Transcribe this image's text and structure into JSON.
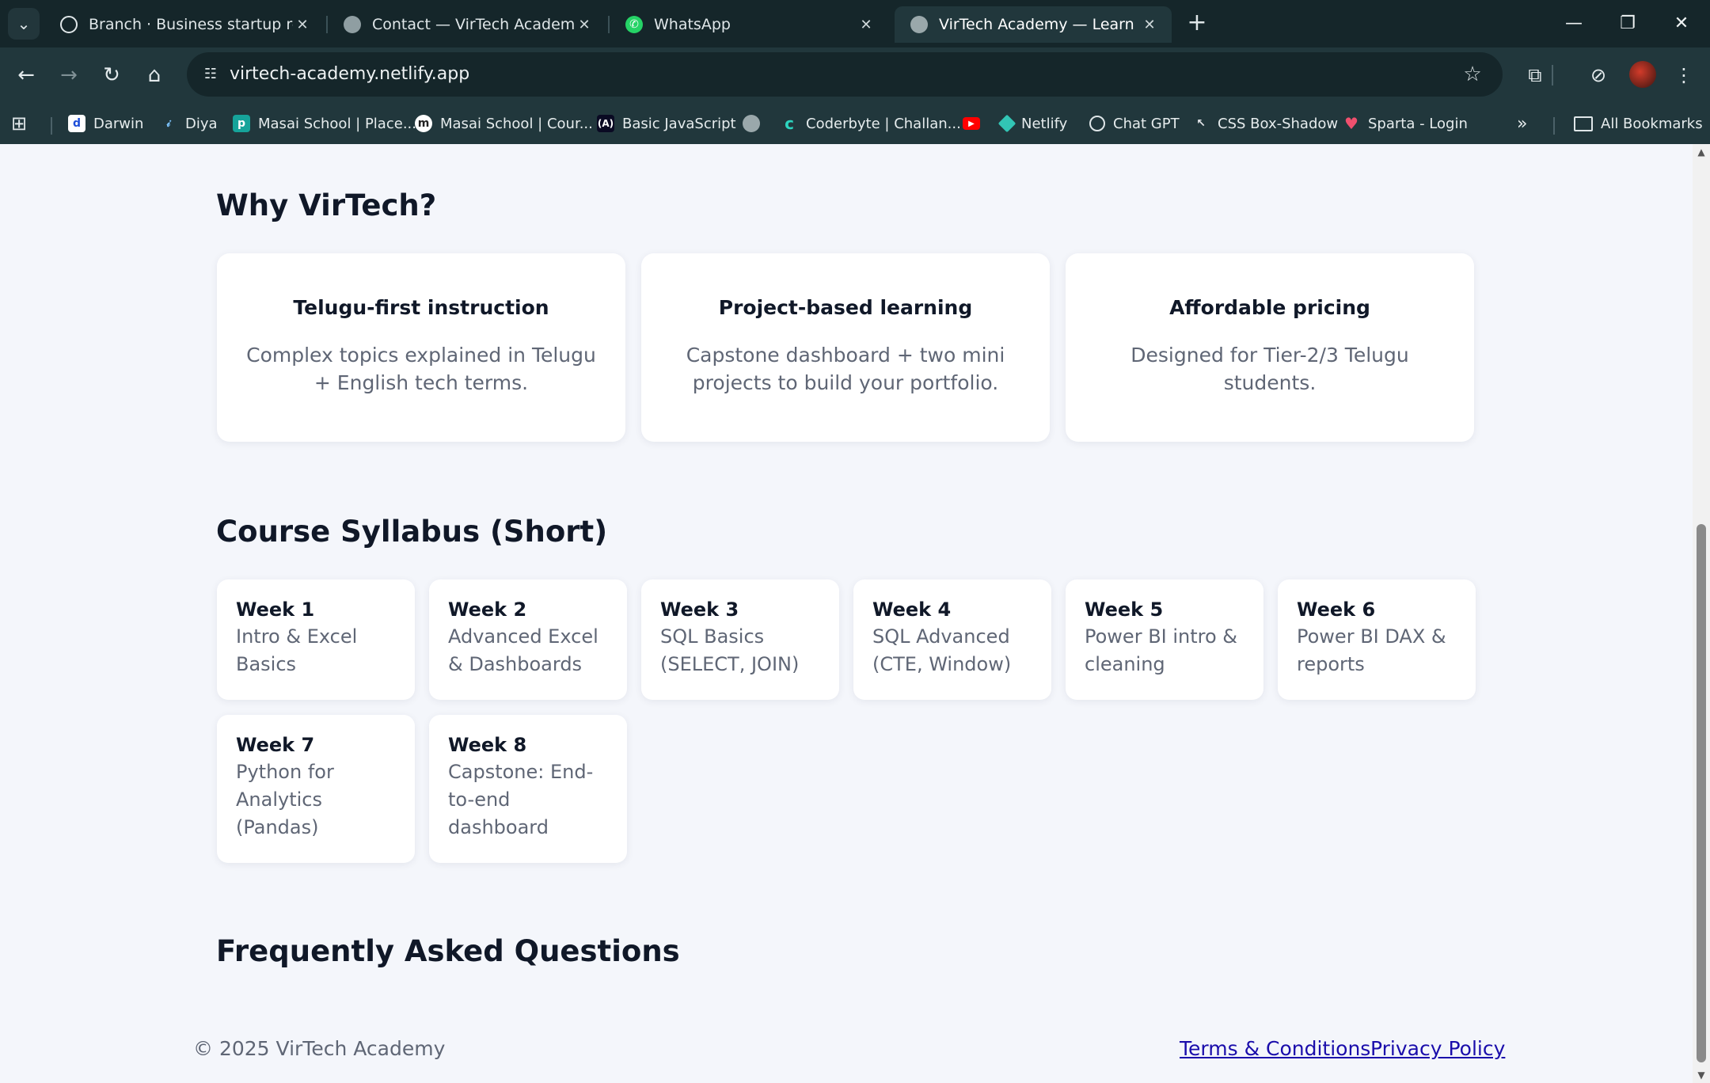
{
  "browser": {
    "tabs": [
      {
        "title": "Branch · Business startup roadm",
        "icon": "chatgpt-icon"
      },
      {
        "title": "Contact — VirTech Academy",
        "icon": "globe-icon"
      },
      {
        "title": "WhatsApp",
        "icon": "whatsapp-icon"
      },
      {
        "title": "VirTech Academy — Learn Data",
        "icon": "globe-icon",
        "active": true
      }
    ],
    "url": "virtech-academy.netlify.app",
    "bookmarks": [
      {
        "label": "Darwin",
        "icon": "d"
      },
      {
        "label": "Diya",
        "icon": "diya"
      },
      {
        "label": "Masai School | Place...",
        "icon": "p"
      },
      {
        "label": "Masai School | Cour...",
        "icon": "m"
      },
      {
        "label": "Basic JavaScript",
        "icon": "A"
      },
      {
        "label": "",
        "icon": "globe"
      },
      {
        "label": "Coderbyte | Challan...",
        "icon": "c"
      },
      {
        "label": "",
        "icon": "youtube"
      },
      {
        "label": "Netlify",
        "icon": "netlify"
      },
      {
        "label": "Chat GPT",
        "icon": "chatgpt"
      },
      {
        "label": "CSS Box-Shadow",
        "icon": "css"
      },
      {
        "label": "Sparta - Login",
        "icon": "heart"
      }
    ],
    "all_bookmarks_label": "All Bookmarks"
  },
  "why": {
    "heading": "Why VirTech?",
    "cards": [
      {
        "title": "Telugu-first instruction",
        "desc": "Complex topics explained in Telugu + English tech terms."
      },
      {
        "title": "Project-based learning",
        "desc": "Capstone dashboard + two mini projects to build your portfolio."
      },
      {
        "title": "Affordable pricing",
        "desc": "Designed for Tier-2/3 Telugu students."
      }
    ]
  },
  "syllabus": {
    "heading": "Course Syllabus (Short)",
    "weeks": [
      {
        "title": "Week 1",
        "desc": "Intro & Excel Basics"
      },
      {
        "title": "Week 2",
        "desc": "Advanced Excel & Dashboards"
      },
      {
        "title": "Week 3",
        "desc": "SQL Basics (SELECT, JOIN)"
      },
      {
        "title": "Week 4",
        "desc": "SQL Advanced (CTE, Window)"
      },
      {
        "title": "Week 5",
        "desc": "Power BI intro & cleaning"
      },
      {
        "title": "Week 6",
        "desc": "Power BI DAX & reports"
      },
      {
        "title": "Week 7",
        "desc": "Python for Analytics (Pandas)"
      },
      {
        "title": "Week 8",
        "desc": "Capstone: End-to-end dashboard"
      }
    ]
  },
  "faq": {
    "heading": "Frequently Asked Questions"
  },
  "footer": {
    "copyright": "© 2025 VirTech Academy",
    "terms": "Terms & Conditions",
    "privacy": "Privacy Policy"
  }
}
